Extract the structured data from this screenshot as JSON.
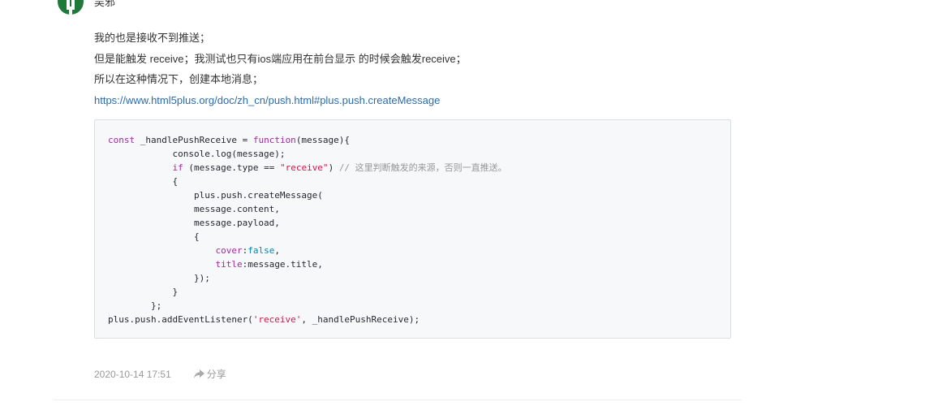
{
  "comment": {
    "username": "吴邪",
    "lines": [
      "我的也是接收不到推送；",
      "但是能触发 receive；我测试也只有ios端应用在前台显示 的时候会触发receive；",
      "所以在这种情况下，创建本地消息；"
    ],
    "link": "https://www.html5plus.org/doc/zh_cn/push.html#plus.push.createMessage",
    "code": {
      "l1_a": "const",
      "l1_b": " _handlePushReceive = ",
      "l1_c": "function",
      "l1_d": "(message){",
      "l2": "            console.log(message);",
      "l3_a": "            ",
      "l3_b": "if",
      "l3_c": " (message.type == ",
      "l3_d": "\"receive\"",
      "l3_e": ") ",
      "l3_f": "// 这里判断触发的来源，否则一直推送。",
      "l4": "            {",
      "l5": "                plus.push.createMessage(",
      "l6": "                message.content,",
      "l7": "                message.payload,",
      "l8": "                {",
      "l9_a": "                    ",
      "l9_b": "cover",
      "l9_c": ":",
      "l9_d": "false",
      "l9_e": ",",
      "l10_a": "                    ",
      "l10_b": "title",
      "l10_c": ":message.title,",
      "l11": "                });",
      "l12": "            }",
      "l13": "        };",
      "l14_a": "plus.push.addEventListener(",
      "l14_b": "'receive'",
      "l14_c": ", _handlePushReceive);"
    },
    "timestamp": "2020-10-14 17:51",
    "share_label": "分享"
  }
}
